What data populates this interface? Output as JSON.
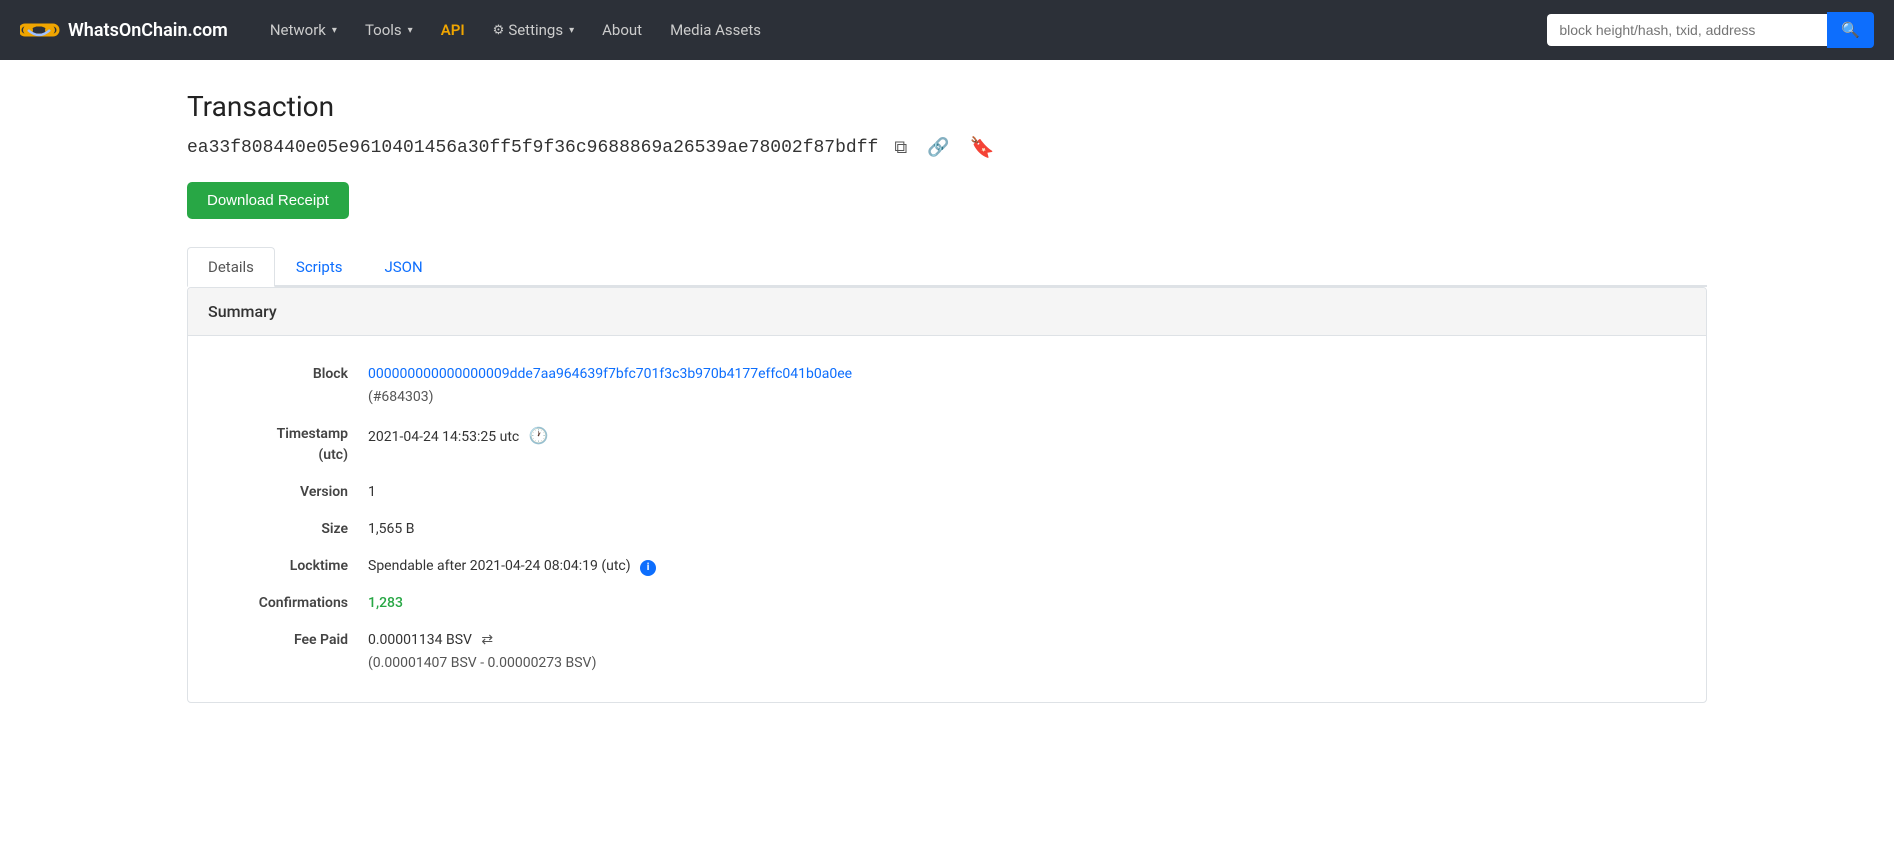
{
  "navbar": {
    "brand_name": "WhatsOnChain.com",
    "nav_items": [
      {
        "label": "Network",
        "has_dropdown": true,
        "class": ""
      },
      {
        "label": "Tools",
        "has_dropdown": true,
        "class": ""
      },
      {
        "label": "API",
        "has_dropdown": false,
        "class": "api"
      },
      {
        "label": "Settings",
        "has_dropdown": true,
        "class": "",
        "has_gear": true
      },
      {
        "label": "About",
        "has_dropdown": false,
        "class": ""
      },
      {
        "label": "Media Assets",
        "has_dropdown": false,
        "class": ""
      }
    ],
    "search_placeholder": "block height/hash, txid, address"
  },
  "page": {
    "title": "Transaction",
    "tx_hash": "ea33f808440e05e9610401456a30ff5f9f36c9688869a26539ae78002f87bdff",
    "download_receipt_label": "Download Receipt"
  },
  "tabs": [
    {
      "label": "Details",
      "active": true
    },
    {
      "label": "Scripts",
      "active": false
    },
    {
      "label": "JSON",
      "active": false
    }
  ],
  "summary": {
    "header": "Summary",
    "rows": [
      {
        "label": "Block",
        "value": "000000000000000009dde7aa964639f7bfc701f3c3b970b4177effc041b0a0ee",
        "sub_value": "(#684303)",
        "is_link": true
      },
      {
        "label": "Timestamp (utc)",
        "value": "2021-04-24 14:53:25 utc",
        "has_clock": true
      },
      {
        "label": "Version",
        "value": "1"
      },
      {
        "label": "Size",
        "value": "1,565 B"
      },
      {
        "label": "Locktime",
        "value": "Spendable after 2021-04-24 08:04:19 (utc)",
        "has_info": true
      },
      {
        "label": "Confirmations",
        "value": "1,283",
        "is_confirmations": true
      },
      {
        "label": "Fee Paid",
        "value": "0.00001134 BSV",
        "has_transfer": true,
        "sub_value": "(0.00001407 BSV - 0.00000273 BSV)"
      }
    ]
  },
  "icons": {
    "copy": "⧉",
    "link": "🔗",
    "bookmark": "🔖",
    "search": "🔍",
    "clock": "🕐",
    "info": "i",
    "transfer": "⇌"
  }
}
